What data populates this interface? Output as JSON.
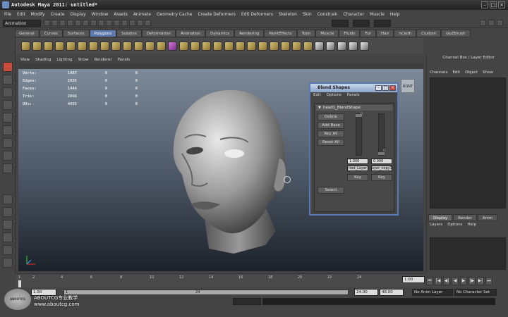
{
  "window": {
    "title": "Autodesk Maya 2011: untitled*"
  },
  "menubar": [
    "File",
    "Edit",
    "Modify",
    "Create",
    "Display",
    "Window",
    "Assets",
    "Animate",
    "Geometry Cache",
    "Create Deformers",
    "Edit Deformers",
    "Skeleton",
    "Skin",
    "Constrain",
    "Character",
    "Muscle",
    "Help"
  ],
  "statusline": {
    "menu_set": "Animation"
  },
  "shelf_tabs": [
    "General",
    "Curves",
    "Surfaces",
    "Polygons",
    "Subdivs",
    "Deformation",
    "Animation",
    "Dynamics",
    "Rendering",
    "PaintEffects",
    "Toon",
    "Muscle",
    "Fluids",
    "Fur",
    "Hair",
    "nCloth",
    "Custom",
    "GoZBrush"
  ],
  "shelf_active": "Polygons",
  "viewport": {
    "menu": [
      "View",
      "Shading",
      "Lighting",
      "Show",
      "Renderer",
      "Panels"
    ],
    "hud": [
      {
        "label": "Verts:",
        "v1": "1487",
        "v2": "0",
        "v3": "0"
      },
      {
        "label": "Edges:",
        "v1": "2935",
        "v2": "0",
        "v3": "0"
      },
      {
        "label": "Faces:",
        "v1": "1444",
        "v2": "0",
        "v3": "0"
      },
      {
        "label": "Tris:",
        "v1": "2866",
        "v2": "0",
        "v3": "0"
      },
      {
        "label": "UVs:",
        "v1": "4455",
        "v2": "0",
        "v3": "0"
      }
    ],
    "viewcube_label": "RONT"
  },
  "blend_dialog": {
    "title": "Blend Shapes",
    "menu": [
      "Edit",
      "Options",
      "Panels"
    ],
    "node": "head1_BlendShape",
    "buttons": [
      "Delete",
      "Add Base",
      "Key All",
      "Reset All"
    ],
    "select_label": "Select",
    "targets": [
      {
        "value": "1.000",
        "name": "ited_Layer",
        "key": "Key"
      },
      {
        "value": "0.000",
        "name": "ayer_copy1",
        "key": "Key"
      }
    ],
    "slider_tick": "0"
  },
  "right_panel": {
    "title": "Channel Box / Layer Editor",
    "menu": [
      "Channels",
      "Edit",
      "Object",
      "Show"
    ],
    "tabs": [
      "Display",
      "Render",
      "Anim"
    ],
    "active_tab": "Display",
    "layer_menu": [
      "Layers",
      "Options",
      "Help"
    ]
  },
  "timeslider": {
    "ticks": [
      "1",
      "2",
      "4",
      "6",
      "8",
      "10",
      "12",
      "14",
      "16",
      "18",
      "20",
      "22",
      "24"
    ],
    "current_time": "1.00"
  },
  "range": {
    "start": "1.00",
    "inner_start": "1.00",
    "inner_end": "24.00",
    "end": "48.00",
    "current": "1",
    "end_marker": "24",
    "anim_layer": "No Anim Layer",
    "char_set": "No Character Set"
  },
  "watermark": {
    "badge": "ABOUTCG",
    "line1": "ABOUTCG专业教学",
    "line2": "www.aboutcg.com"
  }
}
